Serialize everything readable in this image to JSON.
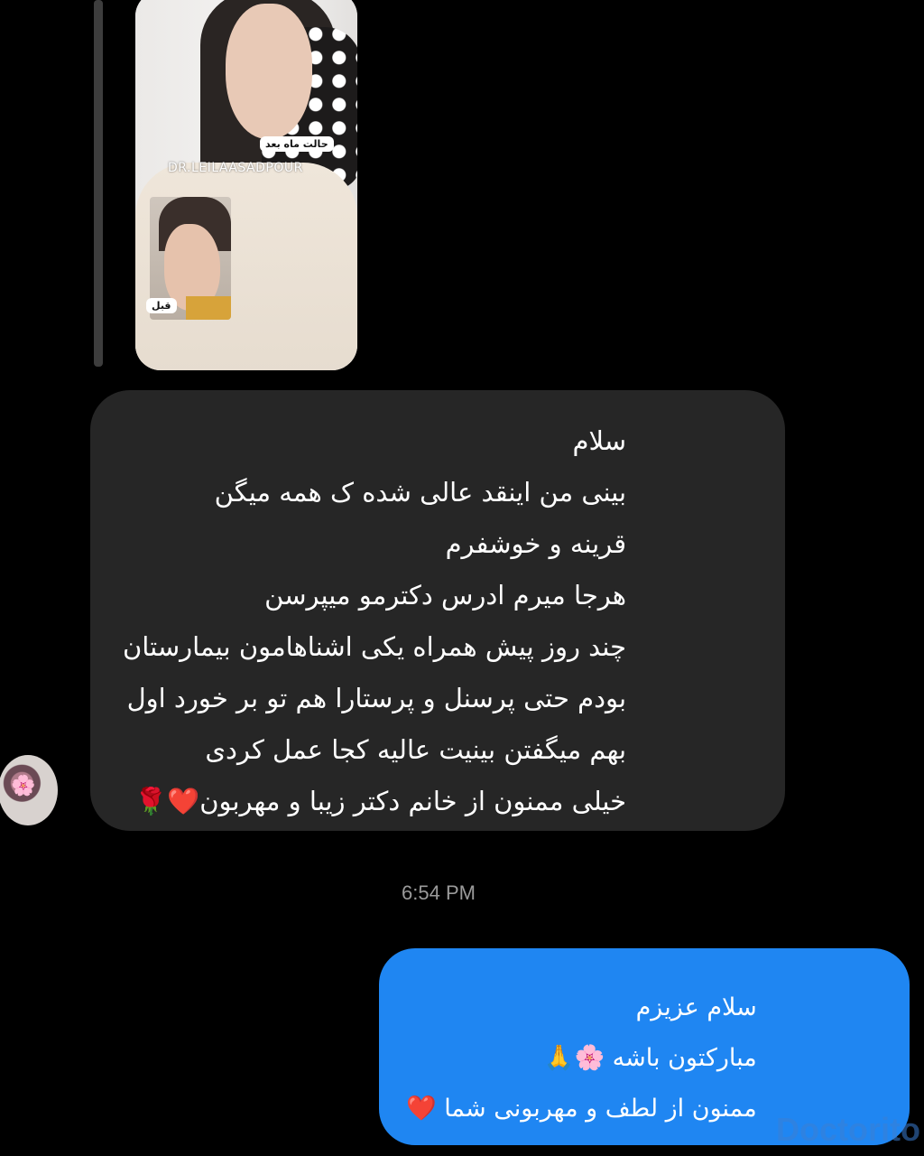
{
  "story": {
    "label_top": "حالت ماه بعد",
    "watermark": "DR.LEILAASADPOUR",
    "label_bottom": "قبل"
  },
  "incoming_message": {
    "lines": [
      "سلام",
      "بینی من اینقد عالی شده ک همه میگن",
      "قرینه و خوشفرم",
      "هرجا میرم ادرس دکترمو میپرسن",
      "چند روز پیش همراه یکی اشناهامون بیمارستان",
      "بودم حتی پرسنل و پرستارا هم تو بر خورد اول",
      "بهم میگفتن بینیت عالیه کجا عمل کردی",
      "خیلی ممنون از خانم دکتر زیبا و مهربون❤️🌹"
    ]
  },
  "timestamp": "6:54 PM",
  "outgoing_message": {
    "lines": [
      "سلام عزیزم",
      "مبارکتون باشه 🌸🙏",
      "ممنون از لطف و مهربونی شما ❤️"
    ]
  },
  "brand_watermark": "Doctorito",
  "colors": {
    "background": "#000000",
    "incoming_bubble": "#262626",
    "outgoing_bubble": "#1f86f2",
    "timestamp": "#9a9a9a"
  }
}
